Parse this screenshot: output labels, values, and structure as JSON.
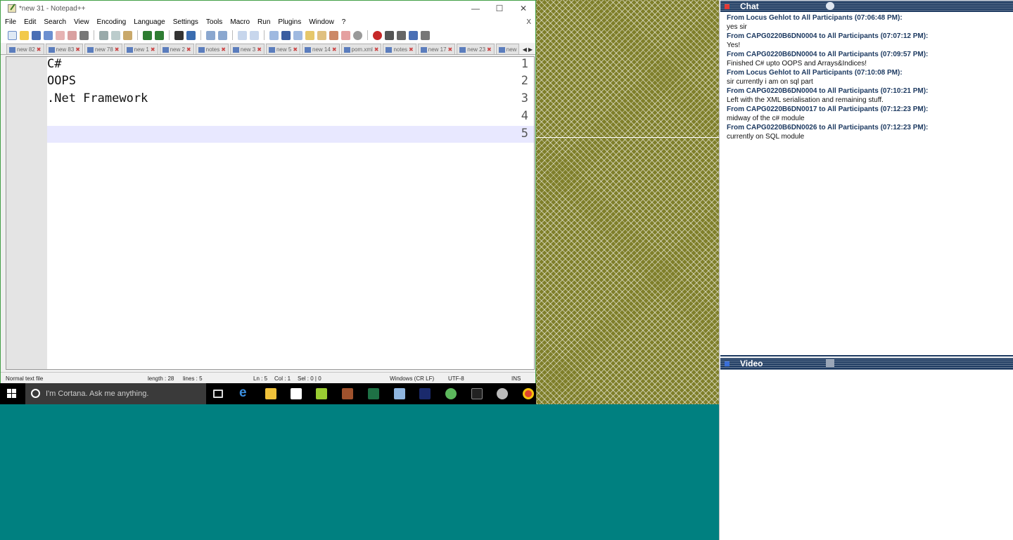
{
  "notepad": {
    "title": "*new 31 - Notepad++",
    "menu": [
      "File",
      "Edit",
      "Search",
      "View",
      "Encoding",
      "Language",
      "Settings",
      "Tools",
      "Macro",
      "Run",
      "Plugins",
      "Window",
      "?"
    ],
    "close_label": "X",
    "tabs": [
      "new 82",
      "new 83",
      "new 78",
      "new 1",
      "new 2",
      "notes",
      "new 3",
      "new 5",
      "new 14",
      "pom.xml",
      "notes",
      "new 17",
      "new 23",
      "new"
    ],
    "line_numbers": [
      "1",
      "2",
      "3",
      "4",
      "5"
    ],
    "lines": [
      "C#",
      "OOPS",
      ".Net Framework",
      "",
      ""
    ],
    "status": {
      "type": "Normal text file",
      "length": "length : 28",
      "lines": "lines : 5",
      "ln": "Ln : 5",
      "col": "Col : 1",
      "sel": "Sel : 0 | 0",
      "eol": "Windows (CR LF)",
      "encoding": "UTF-8",
      "mode": "INS"
    }
  },
  "taskbar": {
    "cortana_placeholder": "I'm Cortana. Ask me anything."
  },
  "chat": {
    "title": "Chat",
    "messages": [
      {
        "from": "From Locus  Gehlot to All Participants (07:06:48 PM):",
        "text": "yes sir"
      },
      {
        "from": "From CAPG0220B6DN0004 to All Participants (07:07:12 PM):",
        "text": "Yes!"
      },
      {
        "from": "From CAPG0220B6DN0004 to All Participants (07:09:57 PM):",
        "text": "Finished C# upto OOPS and Arrays&Indices!"
      },
      {
        "from": "From Locus  Gehlot to All Participants (07:10:08 PM):",
        "text": "sir currently i am on sql part"
      },
      {
        "from": "From CAPG0220B6DN0004 to All Participants (07:10:21 PM):",
        "text": "Left with the XML serialisation and remaining stuff."
      },
      {
        "from": "From CAPG0220B6DN0017 to All Participants (07:12:23 PM):",
        "text": "midway of the c# module"
      },
      {
        "from": "From CAPG0220B6DN0026 to All Participants (07:12:23 PM):",
        "text": "currently on SQL module"
      }
    ]
  },
  "video": {
    "title": "Video"
  },
  "colors": {
    "panel_header": "#1d3a61",
    "desktop_teal": "#008080",
    "desktop_pattern": "#7f7f2a",
    "window_border": "#43a047"
  }
}
